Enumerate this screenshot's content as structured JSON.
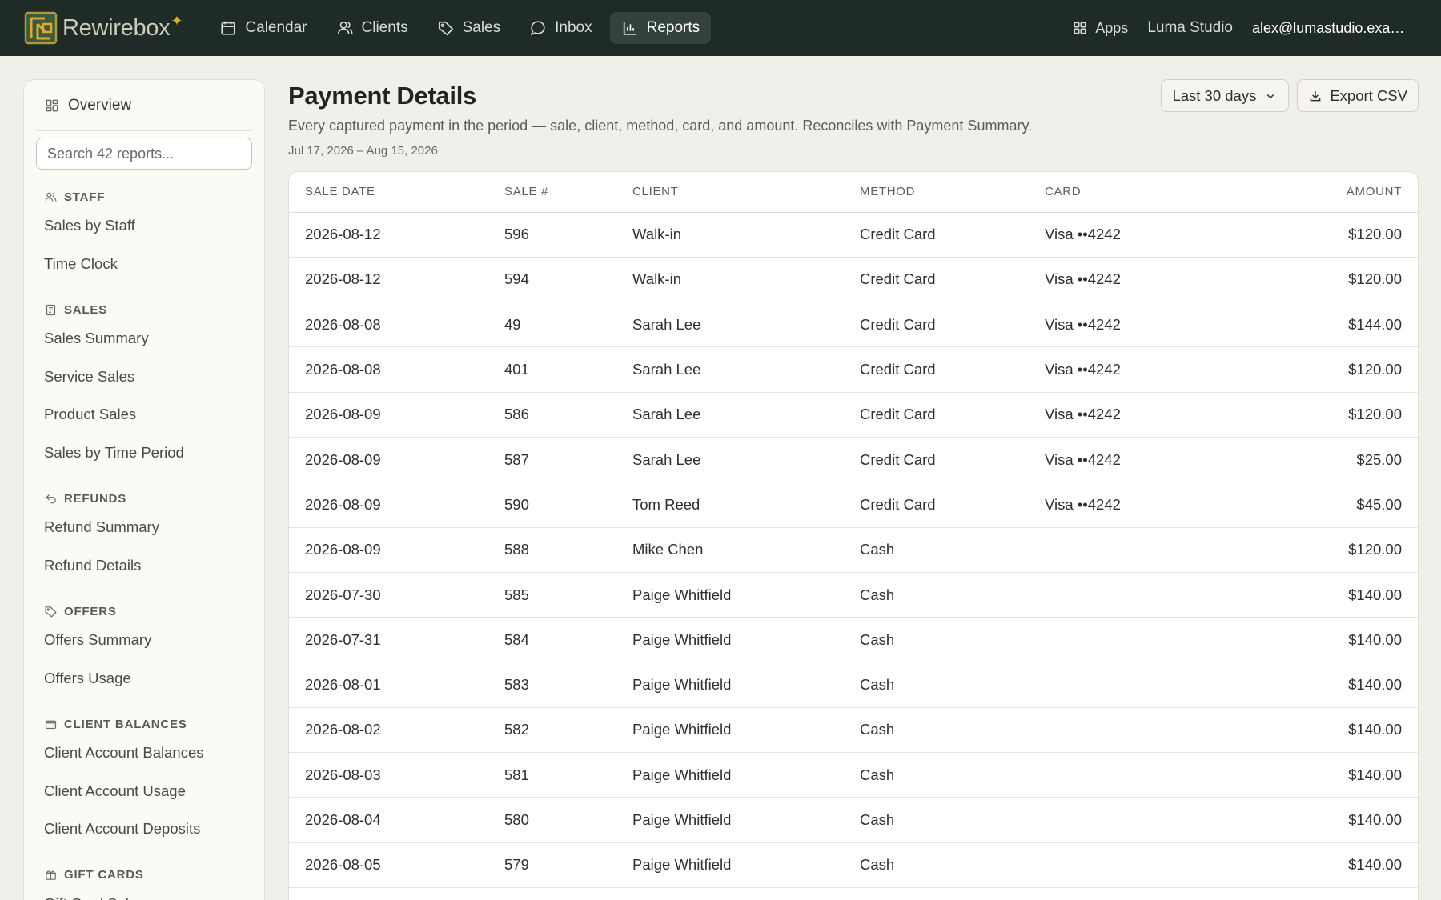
{
  "brand": {
    "name": "Rewirebox",
    "accent": "#e0a82e"
  },
  "nav": [
    {
      "label": "Calendar",
      "icon": "calendar-icon"
    },
    {
      "label": "Clients",
      "icon": "users-icon"
    },
    {
      "label": "Sales",
      "icon": "tag-icon"
    },
    {
      "label": "Inbox",
      "icon": "chat-bubble-icon"
    },
    {
      "label": "Reports",
      "icon": "bar-chart-icon",
      "active": true
    }
  ],
  "topright": {
    "apps_label": "Apps",
    "studio": "Luma Studio",
    "account": "alex@lumastudio.example.com"
  },
  "sidebar": {
    "overview": "Overview",
    "search_placeholder": "Search 42 reports...",
    "sections": [
      {
        "heading": "STAFF",
        "icon": "staff-icon",
        "links": [
          "Sales by Staff",
          "Time Clock"
        ]
      },
      {
        "heading": "SALES",
        "icon": "receipt-icon",
        "links": [
          "Sales Summary",
          "Service Sales",
          "Product Sales",
          "Sales by Time Period"
        ]
      },
      {
        "heading": "REFUNDS",
        "icon": "undo-icon",
        "links": [
          "Refund Summary",
          "Refund Details"
        ]
      },
      {
        "heading": "OFFERS",
        "icon": "tag-icon",
        "links": [
          "Offers Summary",
          "Offers Usage"
        ]
      },
      {
        "heading": "CLIENT BALANCES",
        "icon": "wallet-icon",
        "links": [
          "Client Account Balances",
          "Client Account Usage",
          "Client Account Deposits"
        ]
      },
      {
        "heading": "GIFT CARDS",
        "icon": "gift-icon",
        "links": [
          "Gift Card Sales"
        ]
      }
    ]
  },
  "page": {
    "title": "Payment Details",
    "subtitle": "Every captured payment in the period — sale, client, method, card, and amount. Reconciles with Payment Summary.",
    "range": "Jul 17, 2026 – Aug 15, 2026",
    "period_select": "Last 30 days",
    "export_label": "Export CSV"
  },
  "table": {
    "columns": [
      "SALE DATE",
      "SALE #",
      "CLIENT",
      "METHOD",
      "CARD",
      "AMOUNT"
    ],
    "rows": [
      [
        "2026-08-12",
        "596",
        "Walk-in",
        "Credit Card",
        "Visa ••4242",
        "$120.00"
      ],
      [
        "2026-08-12",
        "594",
        "Walk-in",
        "Credit Card",
        "Visa ••4242",
        "$120.00"
      ],
      [
        "2026-08-08",
        "49",
        "Sarah Lee",
        "Credit Card",
        "Visa ••4242",
        "$144.00"
      ],
      [
        "2026-08-08",
        "401",
        "Sarah Lee",
        "Credit Card",
        "Visa ••4242",
        "$120.00"
      ],
      [
        "2026-08-09",
        "586",
        "Sarah Lee",
        "Credit Card",
        "Visa ••4242",
        "$120.00"
      ],
      [
        "2026-08-09",
        "587",
        "Sarah Lee",
        "Credit Card",
        "Visa ••4242",
        "$25.00"
      ],
      [
        "2026-08-09",
        "590",
        "Tom Reed",
        "Credit Card",
        "Visa ••4242",
        "$45.00"
      ],
      [
        "2026-08-09",
        "588",
        "Mike Chen",
        "Cash",
        "",
        "$120.00"
      ],
      [
        "2026-07-30",
        "585",
        "Paige Whitfield",
        "Cash",
        "",
        "$140.00"
      ],
      [
        "2026-07-31",
        "584",
        "Paige Whitfield",
        "Cash",
        "",
        "$140.00"
      ],
      [
        "2026-08-01",
        "583",
        "Paige Whitfield",
        "Cash",
        "",
        "$140.00"
      ],
      [
        "2026-08-02",
        "582",
        "Paige Whitfield",
        "Cash",
        "",
        "$140.00"
      ],
      [
        "2026-08-03",
        "581",
        "Paige Whitfield",
        "Cash",
        "",
        "$140.00"
      ],
      [
        "2026-08-04",
        "580",
        "Paige Whitfield",
        "Cash",
        "",
        "$140.00"
      ],
      [
        "2026-08-05",
        "579",
        "Paige Whitfield",
        "Cash",
        "",
        "$140.00"
      ]
    ]
  }
}
